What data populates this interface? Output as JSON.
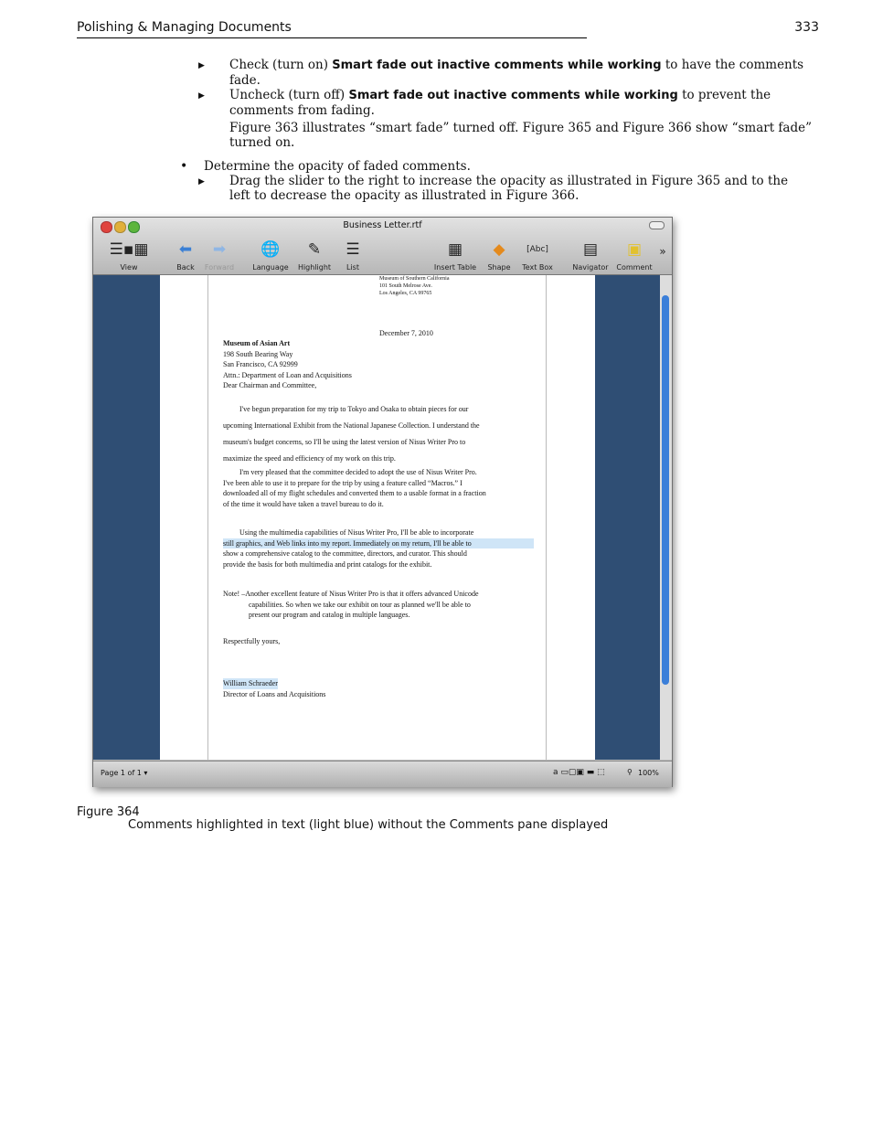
{
  "header": {
    "title": "Polishing & Managing Documents",
    "page_number": "333"
  },
  "bullets": {
    "sub1": {
      "pre": "Check (turn on) ",
      "bold": "Smart fade out inactive comments while working",
      "post": " to have the comments",
      "line2": "fade."
    },
    "sub2": {
      "pre": "Uncheck (turn off) ",
      "bold": "Smart fade out inactive comments while working",
      "post": " to prevent the",
      "line2": "comments from fading."
    },
    "para": {
      "line1": "Figure 363 illustrates “smart fade” turned off. Figure 365 and Figure 366 show “smart fade”",
      "line2": "turned on."
    },
    "main": "Determine the opacity of faded comments.",
    "sub3": {
      "line1": "Drag the slider to the right to increase the opacity as illustrated in Figure 365 and to the",
      "line2": "left to decrease the opacity as illustrated in Figure 366."
    }
  },
  "window": {
    "title": "Business Letter.rtf",
    "toolbar": [
      "View",
      "Back",
      "Forward",
      "Language",
      "Highlight",
      "List",
      "Insert Table",
      "Shape",
      "Text Box",
      "Navigator",
      "Comment"
    ],
    "overflow": "»",
    "status_left": "Page 1 of 1 ▾",
    "zoom": "100%"
  },
  "letter": {
    "return_address": [
      "Museum of Southern California",
      "101 South Melrose Ave.",
      "Los Angeles, CA 99765"
    ],
    "date": "December 7, 2010",
    "recipient": [
      "Museum of Asian Art",
      "198 South Bearing Way",
      "San Francisco, CA 92999",
      "Attn.: Department of Loan and Acquisitions",
      "Dear Chairman and Committee,"
    ],
    "p1": [
      "I've begun preparation for my trip to Tokyo and Osaka to obtain pieces for our",
      "upcoming International Exhibit from the National Japanese Collection. I understand the",
      "museum's budget concerns, so I'll be using the latest version of Nisus Writer Pro to",
      "maximize the speed and efficiency of my work on this trip."
    ],
    "p2": [
      "I'm very pleased that the committee decided to adopt the use of Nisus Writer Pro.",
      "I've been able to use it to prepare for the trip by using a feature called “Macros.” I",
      "downloaded all of my flight schedules and converted them to a usable format in a fraction",
      "of the time it would have taken a travel bureau to do it."
    ],
    "p3": [
      "Using the multimedia capabilities of Nisus Writer Pro, I'll be able to incorporate",
      "still graphics, and Web links into my report. Immediately on my return, I'll be able to",
      "show a comprehensive catalog to the committee, directors, and curator. This should",
      "provide the basis for both multimedia and print catalogs for the exhibit."
    ],
    "note": [
      "Note! –Another excellent feature of Nisus Writer Pro is that it offers advanced Unicode",
      "capabilities. So when we take our exhibit on tour as planned we'll be able to",
      "present our program and catalog in multiple languages."
    ],
    "closing": "Respectfully yours,",
    "sig": "William Schraeder",
    "sig_title": "Director of Loans and Acquisitions"
  },
  "caption": {
    "label": "Figure 364",
    "text": "Comments highlighted in text (light blue) without the Comments pane displayed"
  }
}
